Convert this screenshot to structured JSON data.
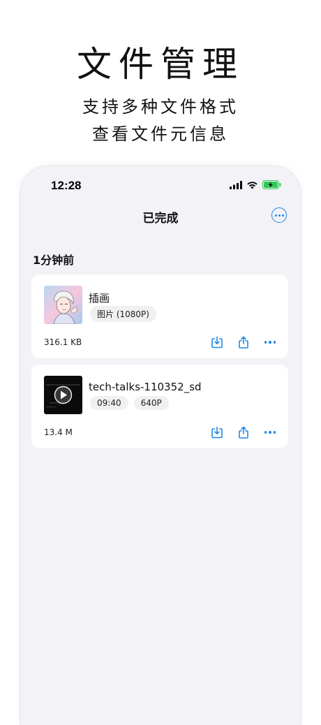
{
  "promo": {
    "headline": "文件管理",
    "line1": "支持多种文件格式",
    "line2": "查看文件元信息"
  },
  "status_bar": {
    "time": "12:28"
  },
  "nav": {
    "title": "已完成"
  },
  "section": {
    "title": "1分钟前"
  },
  "files": [
    {
      "name": "插画",
      "tags": [
        "图片 (1080P)"
      ],
      "size": "316.1 KB"
    },
    {
      "name": "tech-talks-110352_sd",
      "tags": [
        "09:40",
        "640P"
      ],
      "size": "13.4 M"
    }
  ],
  "colors": {
    "accent": "#1e88e5",
    "background": "#f2f2f7",
    "card": "#ffffff",
    "battery": "#34c759"
  },
  "icons": [
    "signal-icon",
    "wifi-icon",
    "battery-charging-icon",
    "more-circle-icon",
    "download-icon",
    "share-icon",
    "more-icon",
    "play-icon"
  ]
}
